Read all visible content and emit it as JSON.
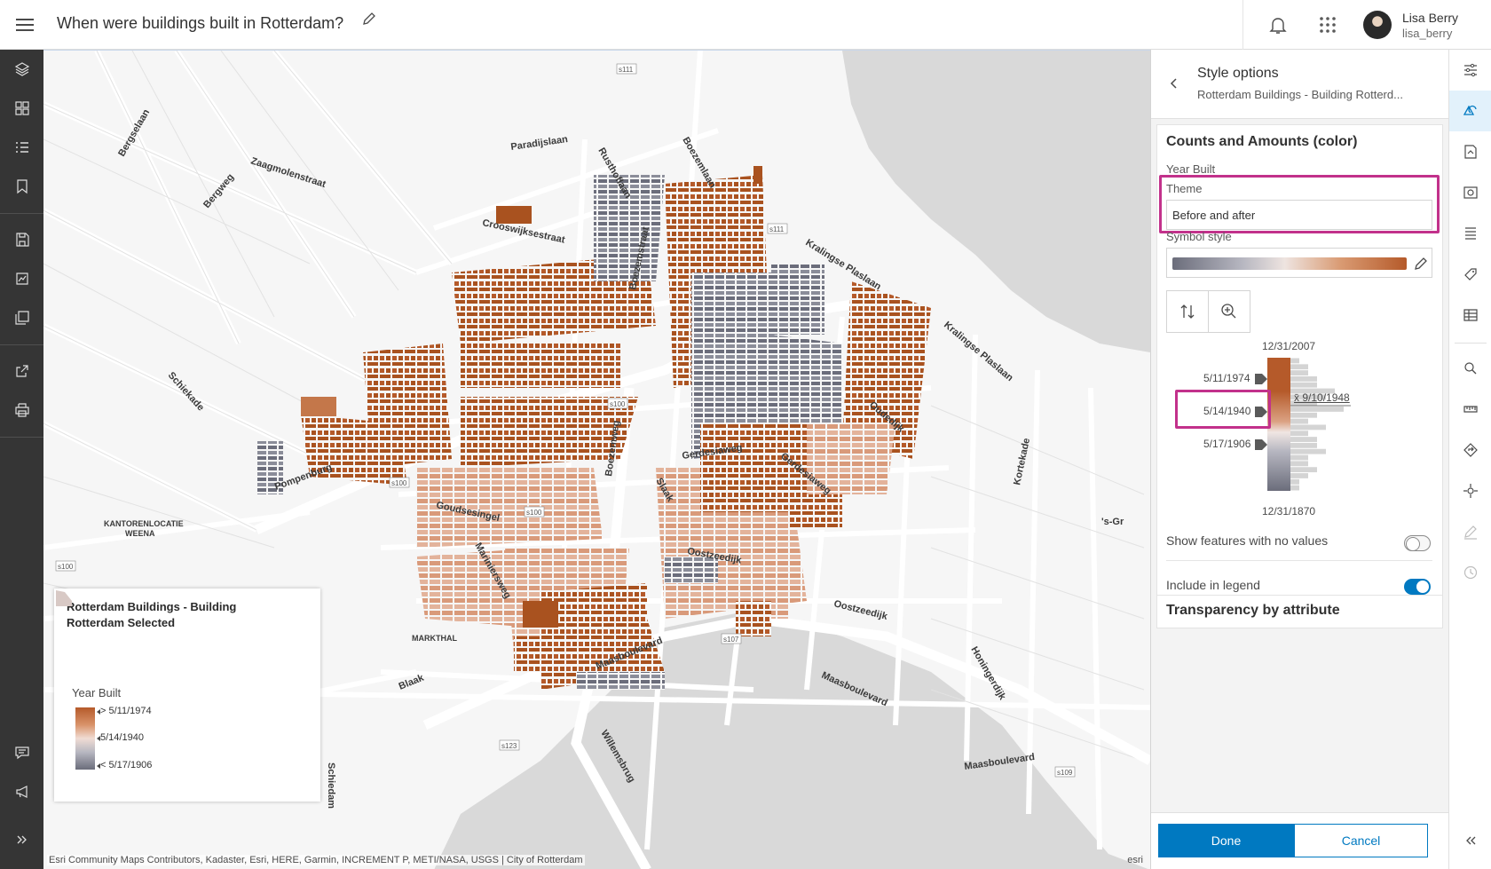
{
  "header": {
    "title": "When were buildings built in Rotterdam?",
    "user_name": "Lisa Berry",
    "user_id": "lisa_berry"
  },
  "map": {
    "attribution": "Esri Community Maps Contributors, Kadaster, Esri, HERE, Garmin, INCREMENT P, METI/NASA, USGS | City of Rotterdam",
    "esri_logo": "esri",
    "labels": [
      "Bergselaan",
      "Bergweg",
      "Zaagmolenstraat",
      "Paradijslaan",
      "Rusthoflaan",
      "Boezemlaan",
      "Crooswijksestraat",
      "Boezemstraat",
      "Kralingse Plaslaan",
      "Kralingse Plaslaan",
      "Schiekade",
      "Oudedijk",
      "Kortekade",
      "Gerdesiaweg",
      "Gerdesiaweg",
      "Boezemweg",
      "Pompenburg",
      "KANTORENLOCATIE",
      "WEENA",
      "Goudsesingel",
      "Slaak",
      "Oostzeedijk",
      "Oostzeedijk",
      "Mariniersweg",
      "MARKTHAL",
      "Blaak",
      "Maasboulevard",
      "Maasboulevard",
      "Maasboulevard",
      "Honingerdijk",
      "Willemsbrug",
      "Schiedam",
      "'s-Gr"
    ],
    "route_shields": [
      "s111",
      "s111",
      "s100",
      "s100",
      "s100",
      "s100",
      "s107",
      "s123",
      "s109"
    ]
  },
  "legend": {
    "title": "Rotterdam Buildings - Building Rotterdam Selected",
    "field": "Year Built",
    "labels": [
      "> 5/11/1974",
      "5/14/1940",
      "< 5/17/1906"
    ]
  },
  "panel": {
    "title": "Style options",
    "subtitle": "Rotterdam Buildings - Building Rotterd...",
    "section_heading": "Counts and Amounts (color)",
    "field": "Year Built",
    "theme_label": "Theme",
    "theme_value": "Before and after",
    "symbol_style_label": "Symbol style",
    "histogram": {
      "max_date": "12/31/2007",
      "min_date": "12/31/1870",
      "handles": [
        "5/11/1974",
        "5/14/1940",
        "5/17/1906"
      ],
      "average": "x̄ 9/10/1948",
      "bins": [
        1,
        2,
        2,
        3,
        3,
        5,
        4,
        3,
        6,
        3,
        2,
        4,
        2,
        3,
        3,
        4,
        2,
        2,
        3,
        2,
        1,
        1
      ]
    },
    "show_no_values_label": "Show features with no values",
    "show_no_values": false,
    "include_legend_label": "Include in legend",
    "include_legend": true,
    "transparency_heading": "Transparency by attribute",
    "done_label": "Done",
    "cancel_label": "Cancel"
  },
  "colors": {
    "accent": "#0079c1",
    "highlight": "#c2318b",
    "ramp_high": "#b55a2a",
    "ramp_mid": "#f0dcd4",
    "ramp_low": "#6b6d7b"
  }
}
